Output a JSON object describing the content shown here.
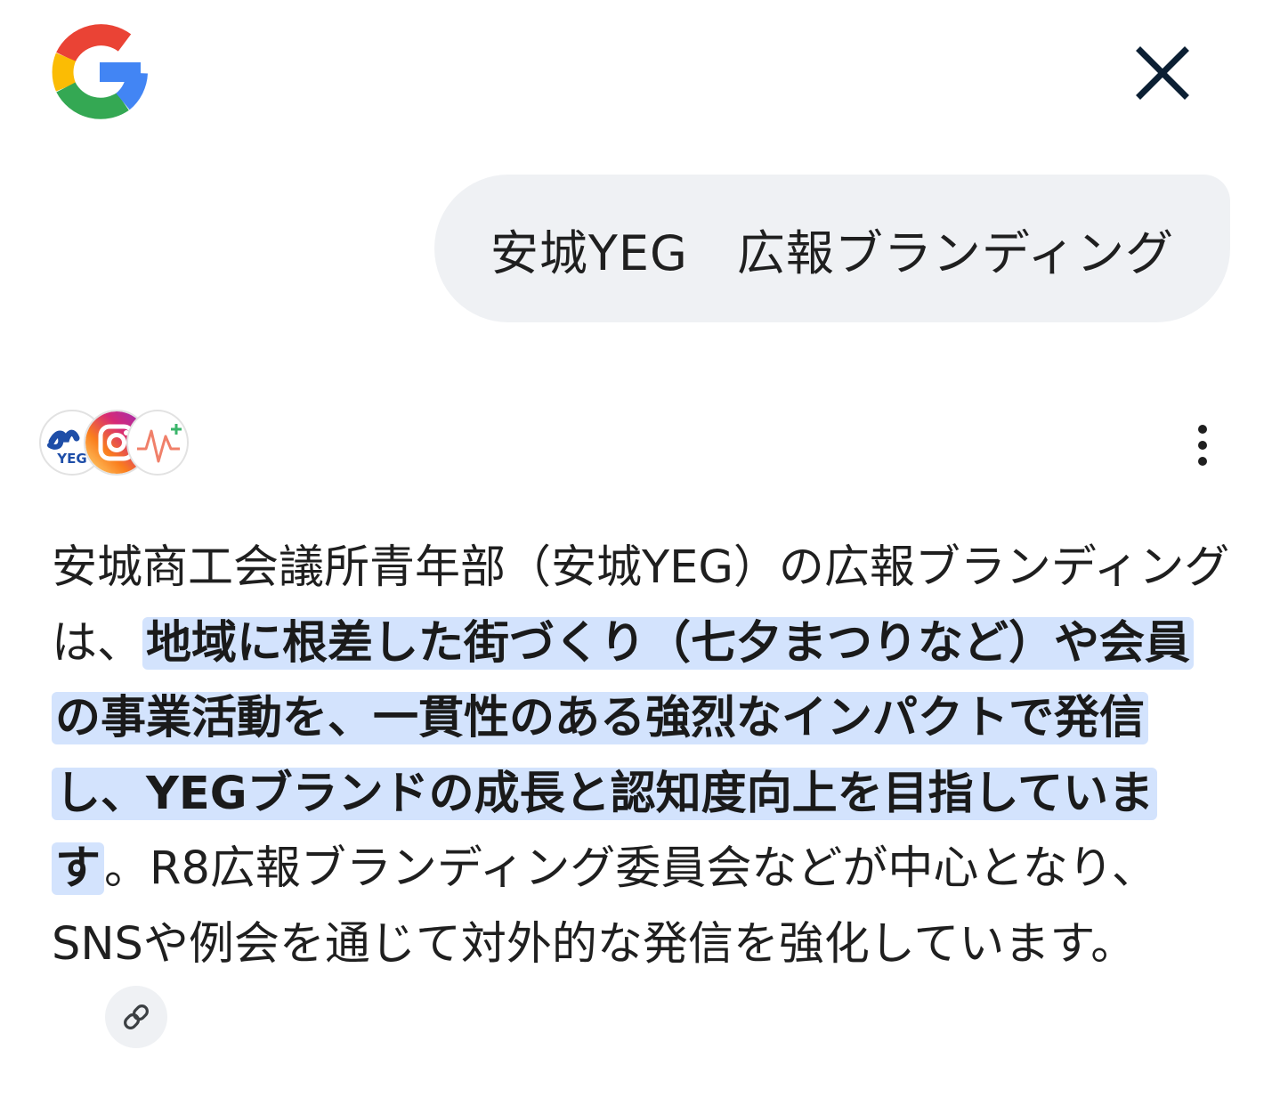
{
  "header": {
    "logo_icon": "google-g-icon",
    "close_icon": "close-icon"
  },
  "query": {
    "text": "安城YEG　広報ブランディング"
  },
  "sources": {
    "avatar_icons": [
      "yeg-logo-icon",
      "instagram-icon",
      "sparkle-pulse-icon"
    ],
    "yeg_logo_text": "YEG",
    "menu_icon": "more-vert-icon"
  },
  "answer": {
    "part1": "安城商工会議所青年部（安城YEG）の広報ブランディングは、",
    "highlight": "地域に根差した街づくり（七夕まつりなど）や会員の事業活動を、一貫性のある強烈なインパクトで発信し、YEGブランドの成長と認知度向上を目指しています",
    "part2": "。R8広報ブランディング委員会などが中心となり、SNSや例会を通じて対外的な発信を強化しています。",
    "link_icon": "link-icon"
  },
  "colors": {
    "bubble_bg": "#eff1f4",
    "highlight_bg": "#d3e3fd",
    "text": "#1f1f1f",
    "close_icon": "#0b1f33"
  }
}
